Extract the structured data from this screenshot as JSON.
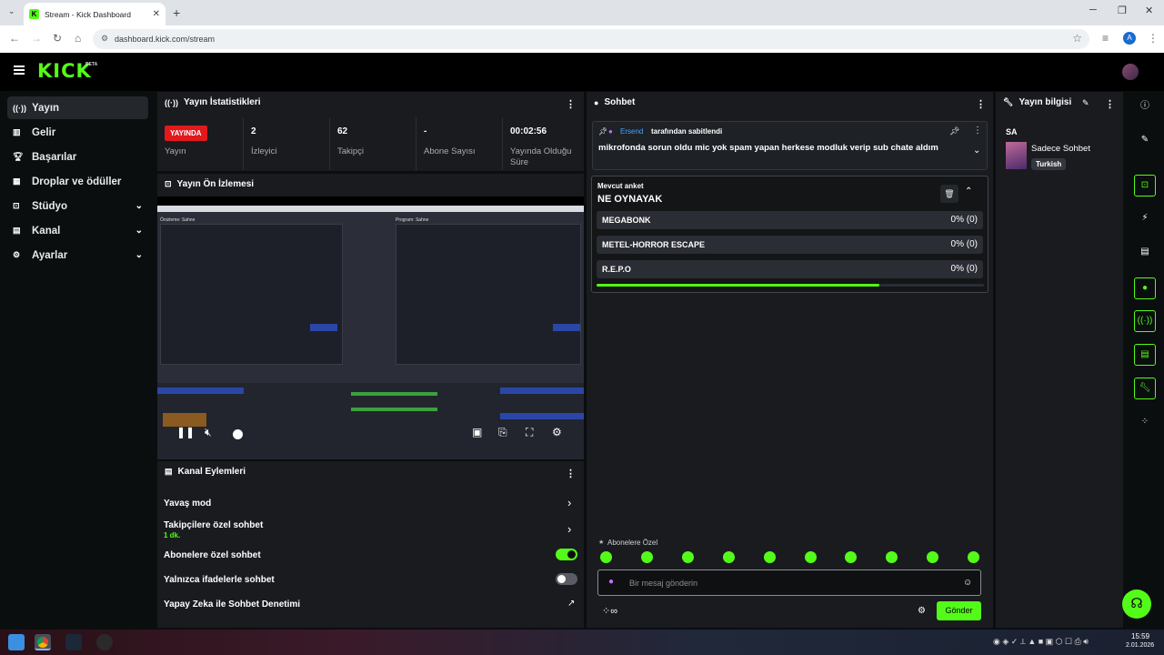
{
  "browser": {
    "tab_title": "Stream - Kick Dashboard",
    "tab_favicon": "K",
    "tab_close": "✕",
    "new_tab": "+",
    "url": "dashboard.kick.com/stream",
    "profile_initial": "A"
  },
  "header": {
    "logo": "KICK",
    "beta": "BETA"
  },
  "sidebar": {
    "items": [
      {
        "label": "Yayın",
        "icon": "broadcast-icon"
      },
      {
        "label": "Gelir",
        "icon": "bank-icon"
      },
      {
        "label": "Başarılar",
        "icon": "trophy-icon"
      },
      {
        "label": "Droplar ve ödüller",
        "icon": "gift-icon"
      },
      {
        "label": "Stüdyo",
        "icon": "studio-icon"
      },
      {
        "label": "Kanal",
        "icon": "channel-icon"
      },
      {
        "label": "Ayarlar",
        "icon": "gear-icon"
      }
    ]
  },
  "stats": {
    "title": "Yayın İstatistikleri",
    "live_badge": "YAYINDA",
    "status_label": "Yayın",
    "viewers_value": "2",
    "viewers_label": "İzleyici",
    "followers_value": "62",
    "followers_label": "Takipçi",
    "subs_value": "-",
    "subs_label": "Abone Sayısı",
    "duration_value": "00:02:56",
    "duration_label": "Yayında Olduğu Süre"
  },
  "preview": {
    "title": "Yayın Ön İzlemesi",
    "obs_left": "Önizleme: Sahne",
    "obs_right": "Program: Sahne"
  },
  "channel_actions": {
    "title": "Kanal Eylemleri",
    "slow_mode": "Yavaş mod",
    "followers_only": "Takipçilere özel sohbet",
    "followers_only_sub": "1 dk.",
    "subs_only": "Abonelere özel sohbet",
    "emotes_only": "Yalnızca ifadelerle sohbet",
    "ai_moderation": "Yapay Zeka ile Sohbet Denetimi"
  },
  "chat": {
    "title": "Sohbet",
    "pinned_user": "Ersend",
    "pinned_by": "tarafından sabitlendi",
    "pinned_message": "mikrofonda sorun oldu mic yok spam yapan herkese modluk verip sub chate aldım",
    "poll_label": "Mevcut anket",
    "poll_question": "NE OYNAYAK",
    "poll_options": [
      {
        "name": "MEGABONK",
        "percent": "0% (0)"
      },
      {
        "name": "METEL-HORROR ESCAPE",
        "percent": "0% (0)"
      },
      {
        "name": "R.E.P.O",
        "percent": "0% (0)"
      }
    ],
    "poll_progress": 0.73,
    "subs_emotes_label": "Abonelere Özel",
    "input_placeholder": "Bir mesaj gönderin",
    "send_label": "Gönder"
  },
  "stream_info": {
    "title": "Yayın bilgisi",
    "stream_title": "SA",
    "category": "Sadece Sohbet",
    "language": "Turkish"
  },
  "taskbar": {
    "time": "15:59",
    "date": "2.01.2026"
  },
  "colors": {
    "accent": "#53fc18",
    "live": "#e0191c",
    "panel": "#191b1f"
  }
}
